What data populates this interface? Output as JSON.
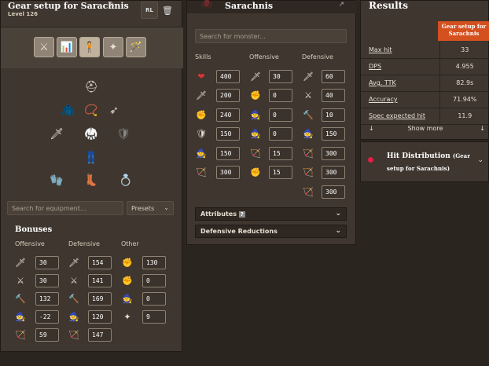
{
  "left": {
    "title": "Gear setup for Sarachnis",
    "level": "Level 126",
    "rl_label": "RL",
    "search_placeholder": "Search for equipment...",
    "presets_label": "Presets",
    "bonuses_title": "Bonuses",
    "offensive_label": "Offensive",
    "defensive_label": "Defensive",
    "other_label": "Other",
    "offensive": [
      "30",
      "30",
      "132",
      "-22",
      "59"
    ],
    "defensive": [
      "154",
      "141",
      "169",
      "120",
      "147"
    ],
    "other": [
      "130",
      "0",
      "0",
      "9"
    ]
  },
  "mid": {
    "title": "Sarachnis",
    "search_placeholder": "Search for monster...",
    "skills_label": "Skills",
    "offensive_label": "Offensive",
    "defensive_label": "Defensive",
    "skills": [
      "400",
      "200",
      "240",
      "150",
      "150",
      "300"
    ],
    "offensive": [
      "30",
      "0",
      "0",
      "0",
      "15",
      "15"
    ],
    "defensive": [
      "60",
      "40",
      "10",
      "150",
      "300",
      "300",
      "300"
    ],
    "attributes_label": "Attributes",
    "attributes_help": "?",
    "def_reductions_label": "Defensive Reductions"
  },
  "right": {
    "title": "Results",
    "col_header": "Gear setup for Sarachnis",
    "rows": [
      {
        "label": "Max hit",
        "value": "33"
      },
      {
        "label": "DPS",
        "value": "4.955"
      },
      {
        "label": "Avg. TTK",
        "value": "82.9s"
      },
      {
        "label": "Accuracy",
        "value": "71.94%"
      },
      {
        "label": "Spec expected hit",
        "value": "11.9"
      }
    ],
    "show_more": "Show more",
    "hit_dist_title": "Hit Distribution",
    "hit_dist_sub": "(Gear setup for Sarachnis)"
  },
  "colors": {
    "accent": "#d4501e",
    "panel": "#3e362f",
    "bg": "#2b2520"
  }
}
